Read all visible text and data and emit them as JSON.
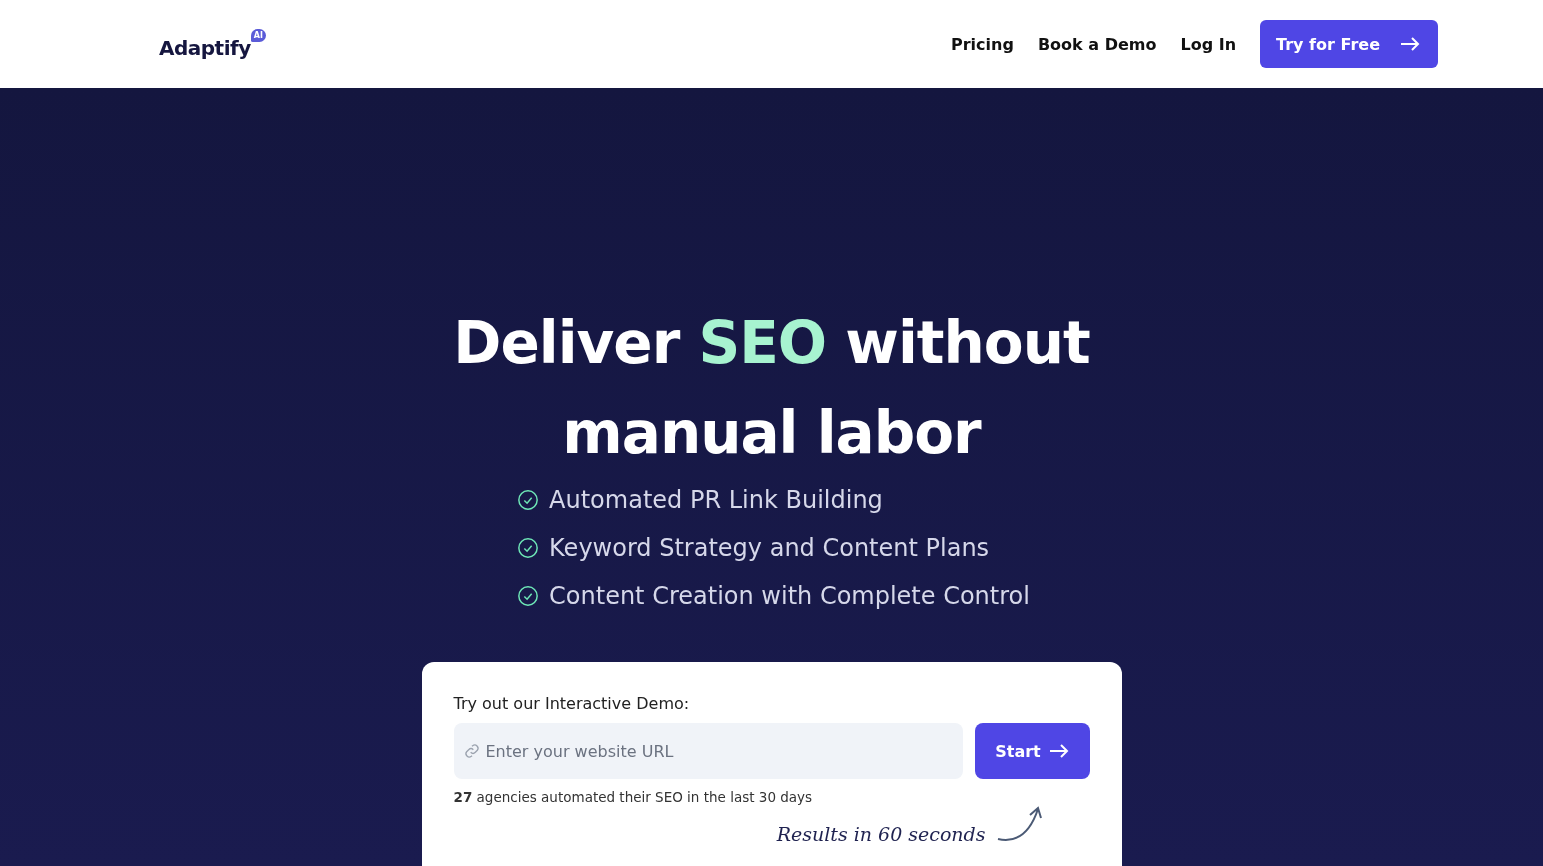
{
  "nav": {
    "logo": "Adaptify",
    "logo_badge": "AI",
    "links": [
      "Pricing",
      "Book a Demo",
      "Log In"
    ],
    "cta": "Try for Free"
  },
  "hero": {
    "headline": [
      {
        "text": "Deliver ",
        "highlight": false
      },
      {
        "text": "SEO",
        "highlight": true
      },
      {
        "text": " without manual labor",
        "highlight": false
      }
    ],
    "features": [
      "Automated PR Link Building",
      "Keyword Strategy and Content Plans",
      "Content Creation with Complete Control"
    ]
  },
  "demo": {
    "label": "Try out our Interactive Demo:",
    "placeholder": "Enter your website URL",
    "button": "Start",
    "stat": "**27** agencies automated their SEO in the last 30 days",
    "note": "Results in 60 seconds"
  }
}
